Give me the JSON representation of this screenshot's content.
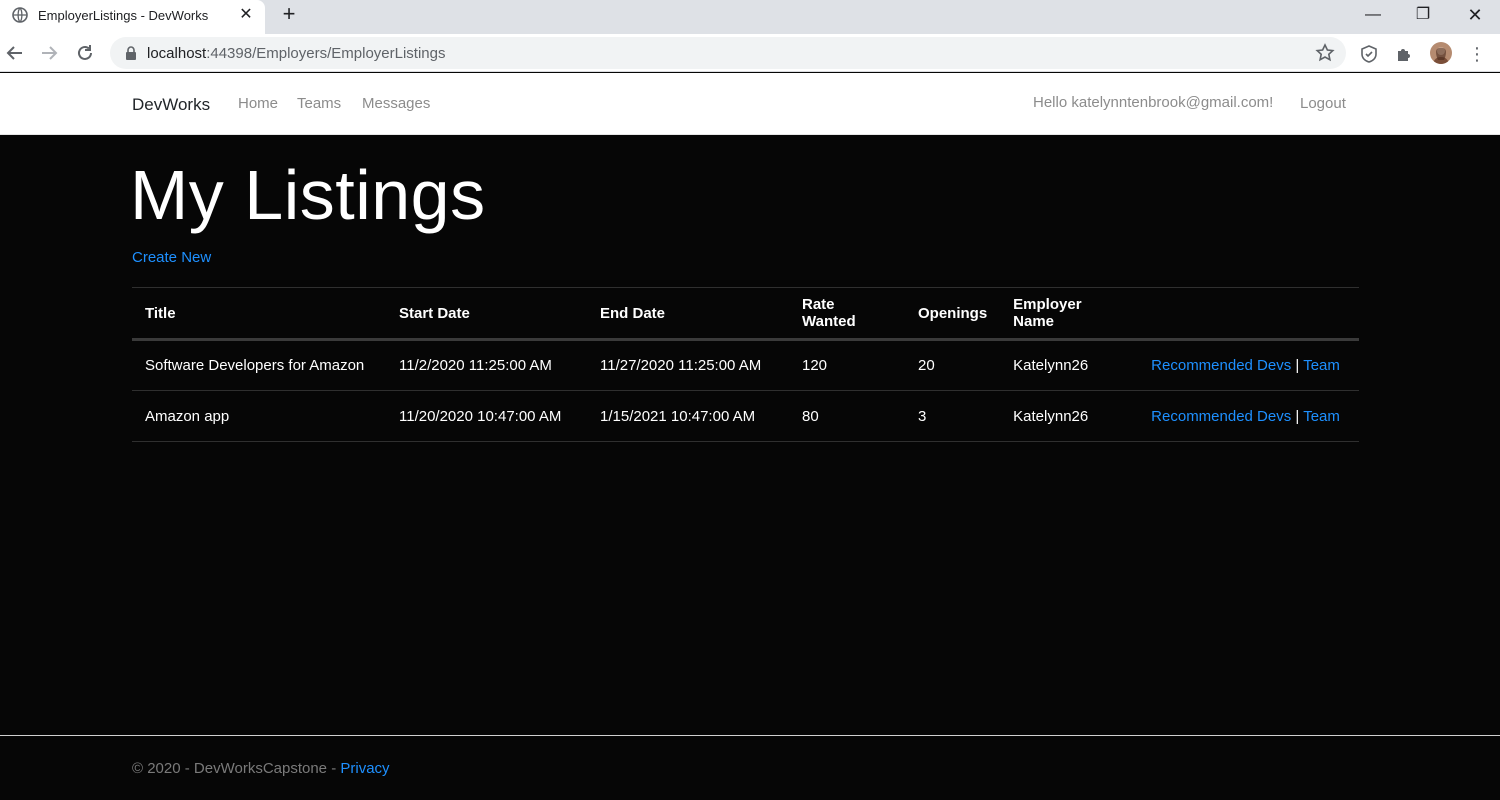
{
  "browser": {
    "tab_title": "EmployerListings - DevWorks",
    "url_host": "localhost",
    "url_path": ":44398/Employers/EmployerListings"
  },
  "nav": {
    "brand": "DevWorks",
    "links": [
      "Home",
      "Teams",
      "Messages"
    ],
    "greeting": "Hello katelynntenbrook@gmail.com!",
    "logout": "Logout"
  },
  "page": {
    "title": "My Listings",
    "create_link": "Create New"
  },
  "table": {
    "headers": [
      "Title",
      "Start Date",
      "End Date",
      "Rate Wanted",
      "Openings",
      "Employer Name"
    ],
    "rows": [
      {
        "title": "Software Developers for Amazon",
        "start_date": "11/2/2020 11:25:00 AM",
        "end_date": "11/27/2020 11:25:00 AM",
        "rate": "120",
        "openings": "20",
        "employer": "Katelynn26",
        "link1": "Recommended Devs",
        "separator": "|",
        "link2": "Team"
      },
      {
        "title": "Amazon app",
        "start_date": "11/20/2020 10:47:00 AM",
        "end_date": "1/15/2021 10:47:00 AM",
        "rate": "80",
        "openings": "3",
        "employer": "Katelynn26",
        "link1": "Recommended Devs",
        "separator": "|",
        "link2": "Team"
      }
    ]
  },
  "footer": {
    "text": "© 2020 - DevWorksCapstone - ",
    "privacy": "Privacy"
  }
}
